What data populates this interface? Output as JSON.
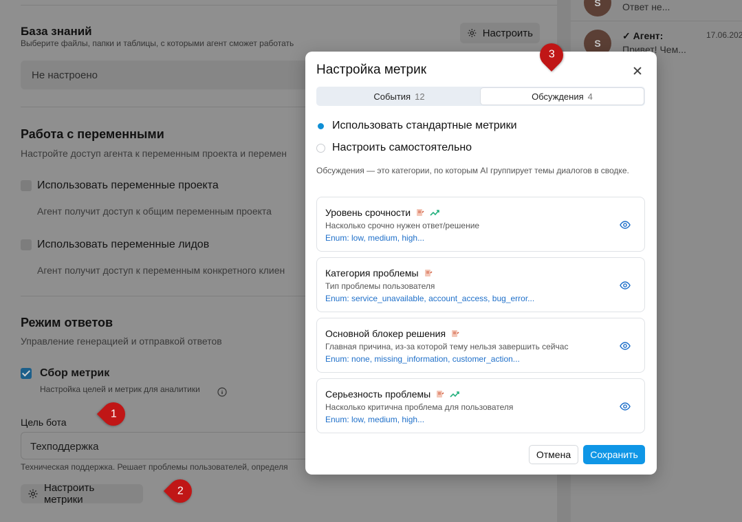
{
  "knowledge": {
    "title": "База знаний",
    "subtitle": "Выберите файлы, папки и таблицы, с которыми агент сможет работать",
    "configure_label": "Настроить",
    "status": "Не настроено"
  },
  "variables": {
    "title": "Работа с переменными",
    "subtitle": "Настройте доступ агента к переменным проекта и перемен",
    "project_vars_label": "Использовать переменные проекта",
    "project_vars_desc": "Агент получит доступ к общим переменным проекта",
    "lead_vars_label": "Использовать переменные лидов",
    "lead_vars_desc": "Агент получит доступ к переменным конкретного клиен"
  },
  "responses": {
    "title": "Режим ответов",
    "subtitle": "Управление генерацией и отправкой ответов",
    "metrics_label": "Сбор метрик",
    "metrics_desc": "Настройка целей и метрик для аналитики",
    "goal_label": "Цель бота",
    "goal_value": "Техподдержка",
    "goal_hint": "Техническая поддержка. Решает проблемы пользователей, определя",
    "configure_metrics_label": "Настроить метрики"
  },
  "chats": {
    "item1_preview": "Ответ не...",
    "item2_sender": "✓ Агент:",
    "item2_date": "17.06.202",
    "item2_preview": "Привет! Чем...",
    "avatar_letter": "S"
  },
  "markers": {
    "m1": "1",
    "m2": "2",
    "m3": "3"
  },
  "modal": {
    "title": "Настройка метрик",
    "tabs": [
      {
        "label": "События",
        "count": "12"
      },
      {
        "label": "Обсуждения",
        "count": "4"
      }
    ],
    "radio_standard": "Использовать стандартные метрики",
    "radio_custom": "Настроить самостоятельно",
    "description": "Обсуждения — это категории, по которым AI группирует темы диалогов в сводке.",
    "metrics": [
      {
        "name": "Уровень срочности",
        "desc": "Насколько срочно нужен ответ/решение",
        "enum": "Enum: low, medium, high..."
      },
      {
        "name": "Категория проблемы",
        "desc": "Тип проблемы пользователя",
        "enum": "Enum: service_unavailable, account_access, bug_error..."
      },
      {
        "name": "Основной блокер решения",
        "desc": "Главная причина, из-за которой тему нельзя завершить сейчас",
        "enum": "Enum: none, missing_information, customer_action..."
      },
      {
        "name": "Серьезность проблемы",
        "desc": "Насколько критична проблема для пользователя",
        "enum": "Enum: low, medium, high..."
      }
    ],
    "cancel_label": "Отмена",
    "save_label": "Сохранить"
  },
  "colors": {
    "accent": "#0f96e6",
    "marker": "#c01616",
    "enum_text": "#1e6fc9",
    "trend": "#22b07d"
  }
}
